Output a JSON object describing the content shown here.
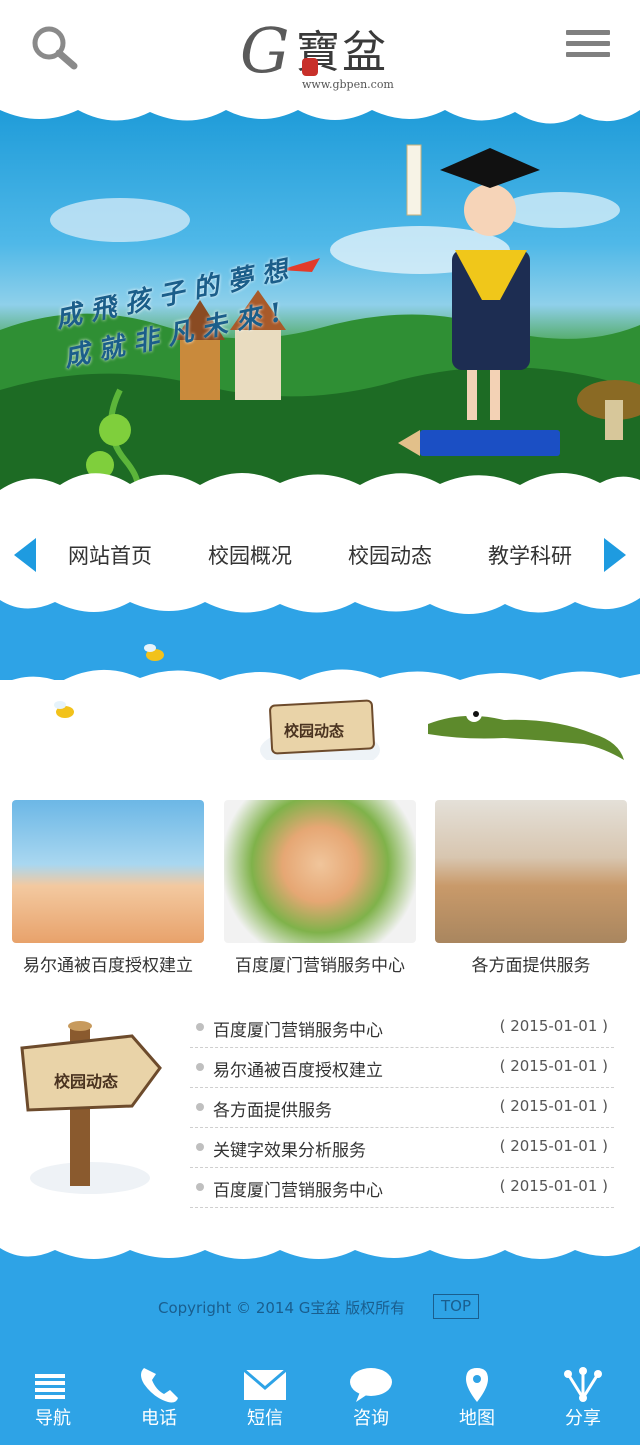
{
  "header": {
    "logo_brand": "G寶盆",
    "logo_url": "www.gbpen.com"
  },
  "banner": {
    "slogan_line1": "成 飛 孩 子 的 夢 想",
    "slogan_line2": "成 就 非 凡 未 來 !"
  },
  "nav": {
    "items": [
      "网站首页",
      "校园概况",
      "校园动态",
      "教学科研"
    ]
  },
  "section": {
    "sign_label": "校园动态"
  },
  "cards": [
    {
      "caption": "易尔通被百度授权建立"
    },
    {
      "caption": "百度厦门营销服务中心"
    },
    {
      "caption": "各方面提供服务"
    }
  ],
  "news": {
    "sign_label": "校园动态",
    "items": [
      {
        "title": "百度厦门营销服务中心",
        "date": "( 2015-01-01 )"
      },
      {
        "title": "易尔通被百度授权建立",
        "date": "( 2015-01-01 )"
      },
      {
        "title": "各方面提供服务",
        "date": "( 2015-01-01 )"
      },
      {
        "title": "关键字效果分析服务",
        "date": "( 2015-01-01 )"
      },
      {
        "title": "百度厦门营销服务中心",
        "date": "( 2015-01-01 )"
      }
    ]
  },
  "footer": {
    "copyright": "Copyright © 2014 G宝盆 版权所有",
    "top_label": "TOP"
  },
  "bottom_bar": {
    "items": [
      {
        "label": "导航",
        "icon": "list-icon"
      },
      {
        "label": "电话",
        "icon": "phone-icon"
      },
      {
        "label": "短信",
        "icon": "mail-icon"
      },
      {
        "label": "咨询",
        "icon": "chat-icon"
      },
      {
        "label": "地图",
        "icon": "map-pin-icon"
      },
      {
        "label": "分享",
        "icon": "share-icon"
      }
    ]
  },
  "colors": {
    "primary_blue": "#2ea3e6",
    "arrow_blue": "#1e9be0",
    "footer_text": "#1a5e8e"
  }
}
